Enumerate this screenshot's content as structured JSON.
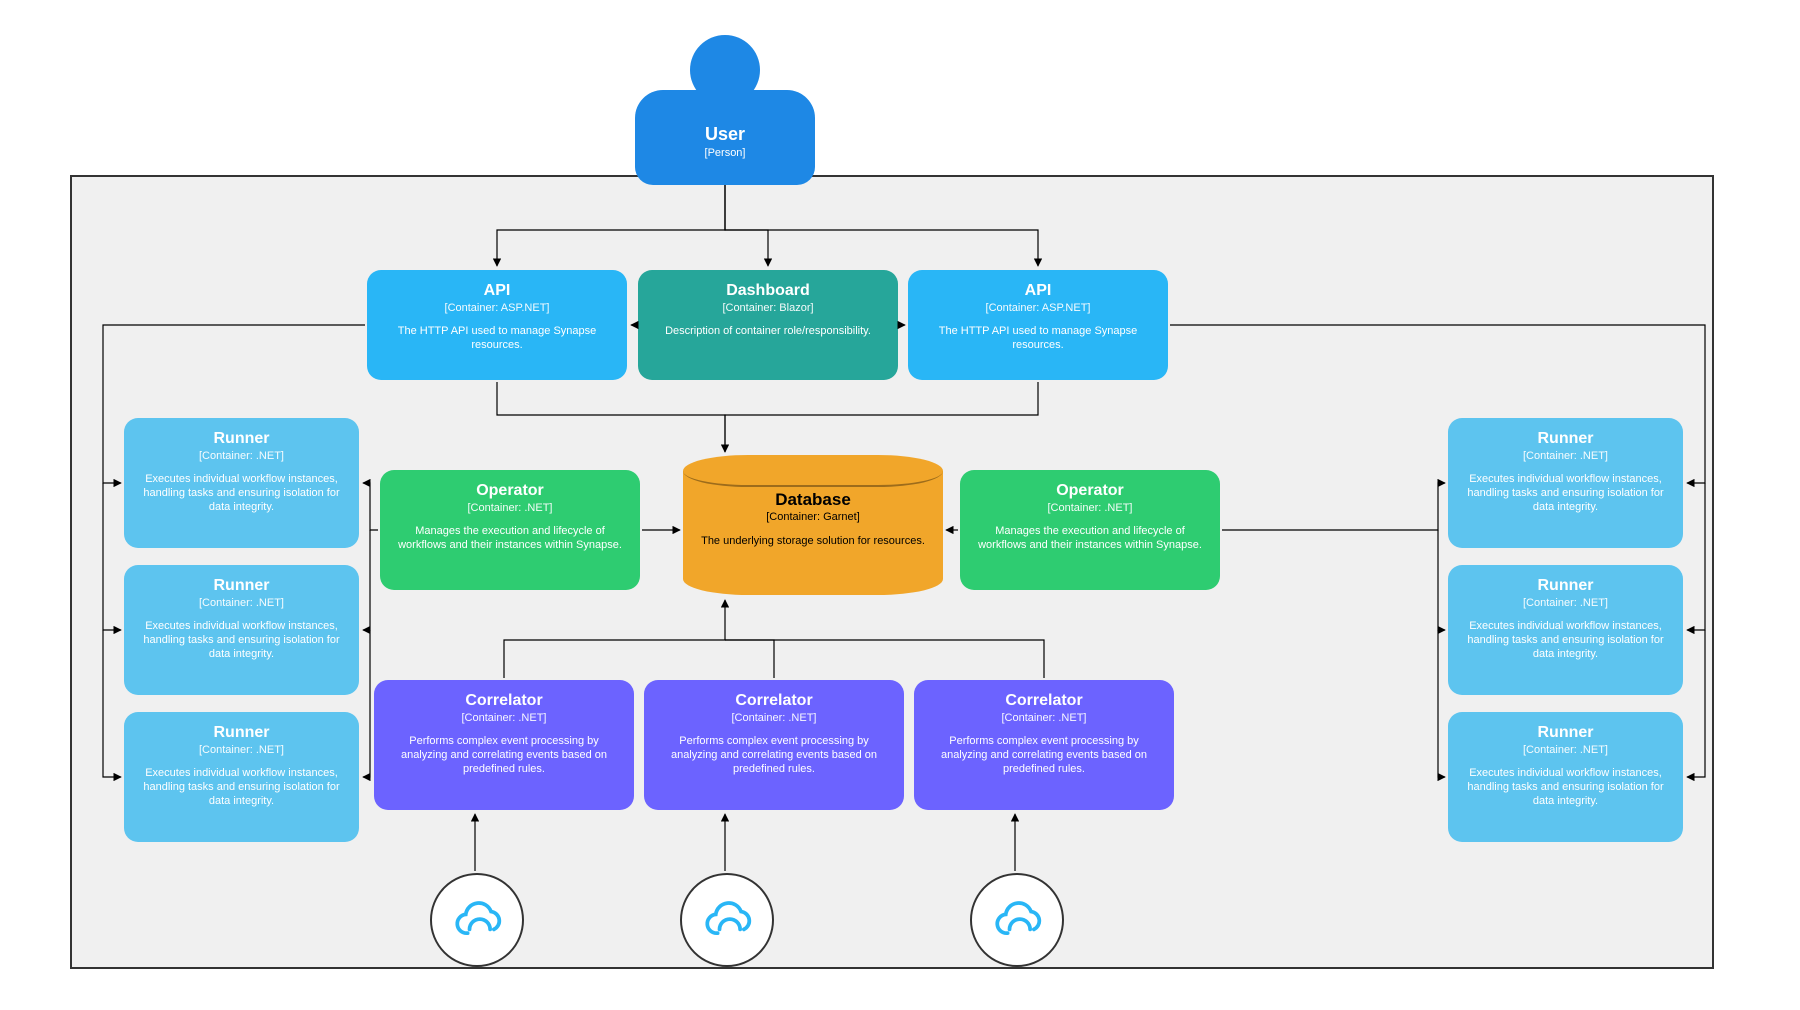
{
  "user": {
    "title": "User",
    "sub": "[Person]"
  },
  "api": {
    "title": "API",
    "sub": "[Container: ASP.NET]",
    "desc": "The HTTP API used to manage Synapse resources."
  },
  "dashboard": {
    "title": "Dashboard",
    "sub": "[Container: Blazor]",
    "desc": "Description of container role/responsibility."
  },
  "operator": {
    "title": "Operator",
    "sub": "[Container: .NET]",
    "desc": "Manages the execution and lifecycle of workflows and their instances within Synapse."
  },
  "database": {
    "title": "Database",
    "sub": "[Container: Garnet]",
    "desc": "The underlying storage solution for resources."
  },
  "correlator": {
    "title": "Correlator",
    "sub": "[Container: .NET]",
    "desc": "Performs complex event processing by analyzing and correlating events based on predefined rules."
  },
  "runner": {
    "title": "Runner",
    "sub": "[Container: .NET]",
    "desc": "Executes individual workflow instances, handling tasks and ensuring isolation for data integrity."
  },
  "colors": {
    "api": "#29b6f6",
    "dashboard": "#26a69a",
    "operator": "#2ecc71",
    "database": "#f1a62a",
    "correlator": "#6c63ff",
    "runner": "#5dc4ef",
    "user": "#1e88e5"
  },
  "diagram": {
    "type": "C4 container diagram",
    "containers": [
      "API (ASP.NET) x2",
      "Dashboard (Blazor)",
      "Operator (.NET) x2",
      "Database (Garnet)",
      "Correlator (.NET) x3",
      "Runner (.NET) x6"
    ],
    "externals": [
      "User (Person)",
      "Cloud event source x3"
    ]
  }
}
